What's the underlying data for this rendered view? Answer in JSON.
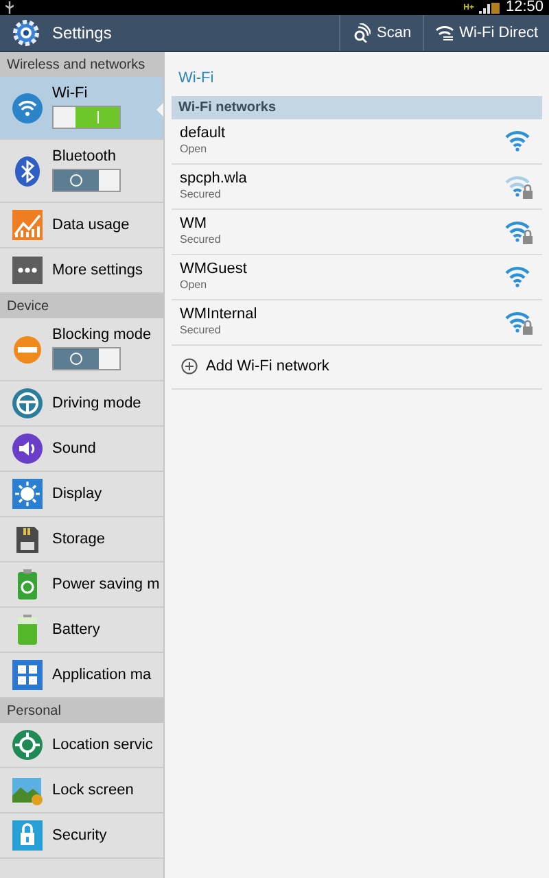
{
  "status_bar": {
    "time": "12:50",
    "network": "H+"
  },
  "action_bar": {
    "title": "Settings",
    "actions": [
      {
        "label": "Scan",
        "kind": "scan"
      },
      {
        "label": "Wi-Fi Direct",
        "kind": "direct"
      }
    ]
  },
  "sidebar": {
    "items": [
      {
        "kind": "header",
        "label": "Wireless and networks"
      },
      {
        "kind": "toggle",
        "label": "Wi-Fi",
        "on": true,
        "selected": true
      },
      {
        "kind": "toggle",
        "label": "Bluetooth",
        "on": false,
        "selected": false
      },
      {
        "kind": "item",
        "label": "Data usage",
        "selected": false
      },
      {
        "kind": "item",
        "label": "More settings",
        "selected": false
      },
      {
        "kind": "header",
        "label": "Device"
      },
      {
        "kind": "toggle",
        "label": "Blocking mode",
        "on": false,
        "selected": false
      },
      {
        "kind": "item",
        "label": "Driving mode",
        "selected": false
      },
      {
        "kind": "item",
        "label": "Sound",
        "selected": false
      },
      {
        "kind": "item",
        "label": "Display",
        "selected": false
      },
      {
        "kind": "item",
        "label": "Storage",
        "selected": false
      },
      {
        "kind": "item",
        "label": "Power saving m",
        "selected": false
      },
      {
        "kind": "item",
        "label": "Battery",
        "selected": false
      },
      {
        "kind": "item",
        "label": "Application ma",
        "selected": false
      },
      {
        "kind": "header",
        "label": "Personal"
      },
      {
        "kind": "item",
        "label": "Location servic",
        "selected": false
      },
      {
        "kind": "item",
        "label": "Lock screen",
        "selected": false
      },
      {
        "kind": "item",
        "label": "Security",
        "selected": false
      }
    ]
  },
  "content": {
    "title": "Wi-Fi",
    "section": "Wi-Fi networks",
    "networks": [
      {
        "name": "default",
        "security": "Open",
        "secured": false,
        "weak_signal": false
      },
      {
        "name": "spcph.wla",
        "security": "Secured",
        "secured": true,
        "weak_signal": true
      },
      {
        "name": "WM",
        "security": "Secured",
        "secured": true,
        "weak_signal": false
      },
      {
        "name": "WMGuest",
        "security": "Open",
        "secured": false,
        "weak_signal": false
      },
      {
        "name": "WMInternal",
        "security": "Secured",
        "secured": true,
        "weak_signal": false
      }
    ],
    "add_label": "Add Wi-Fi network"
  }
}
